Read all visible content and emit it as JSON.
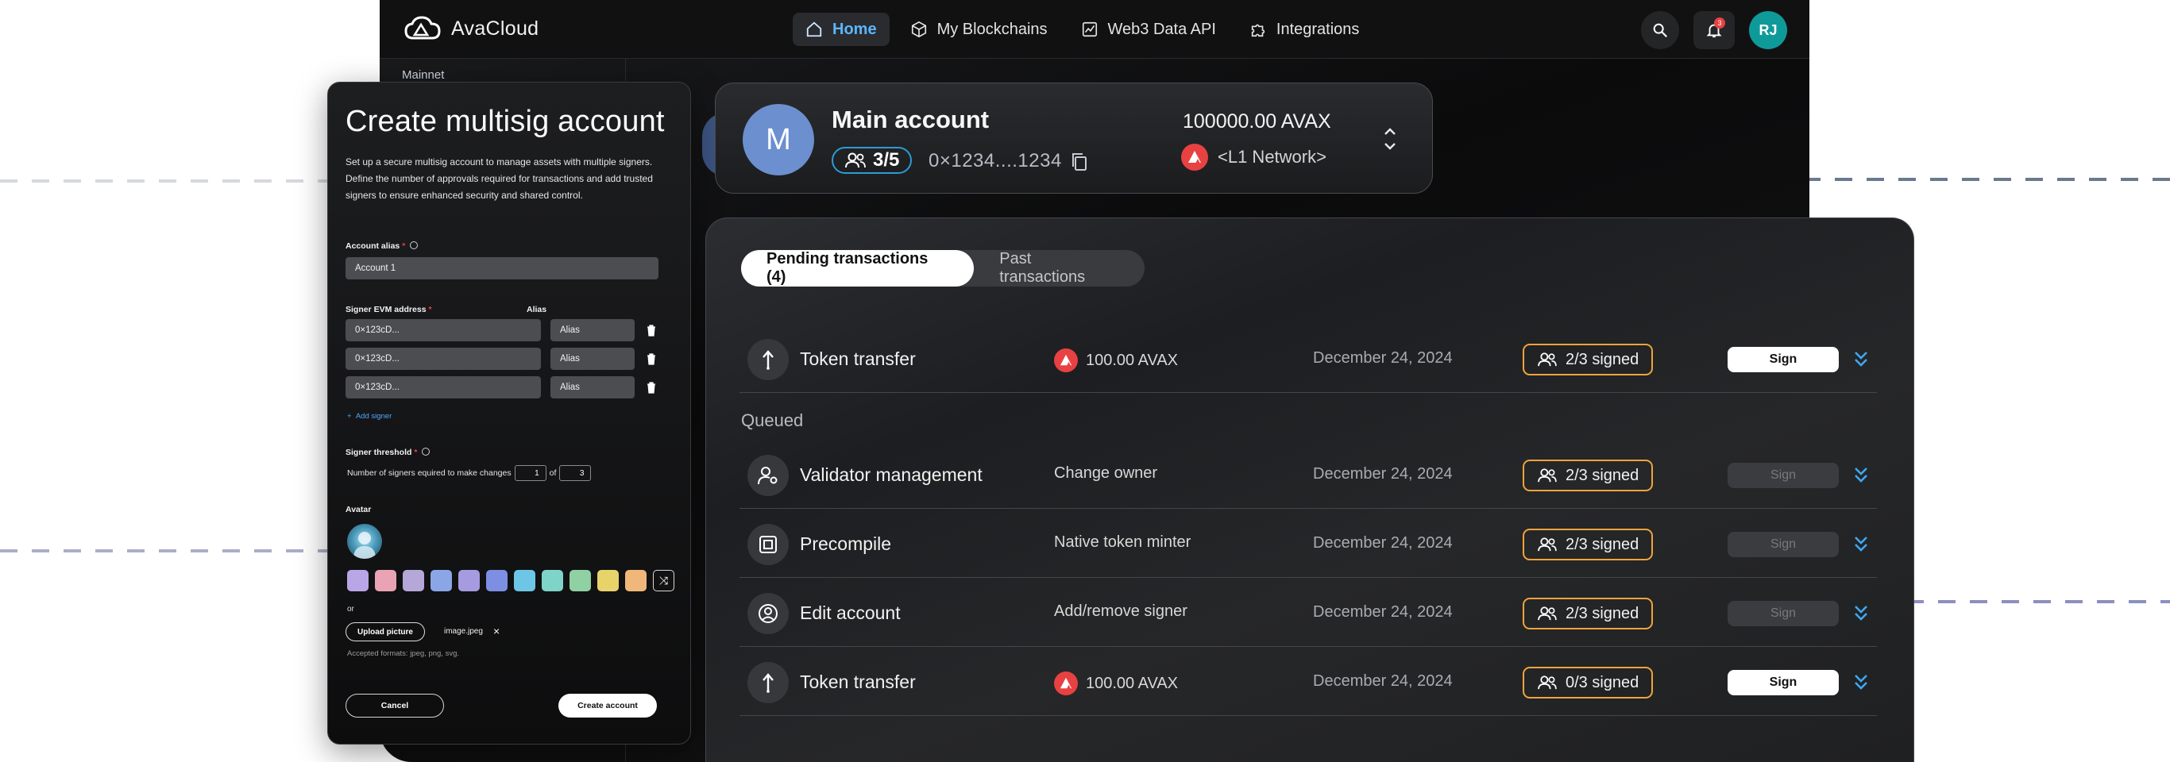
{
  "app": {
    "name": "AvaCloud"
  },
  "nav": {
    "items": [
      {
        "label": "Home",
        "icon": "home-icon",
        "active": true
      },
      {
        "label": "My Blockchains",
        "icon": "cube-icon",
        "active": false
      },
      {
        "label": "Web3 Data API",
        "icon": "chart-icon",
        "active": false
      },
      {
        "label": "Integrations",
        "icon": "puzzle-icon",
        "active": false
      }
    ],
    "notification_count": "3",
    "user_initials": "RJ"
  },
  "sidebar": {
    "network_label": "Mainnet"
  },
  "modal": {
    "title": "Create multisig account",
    "description": "Set up a secure multisig account to manage assets with multiple signers. Define the number of approvals required for transactions and add trusted signers to ensure enhanced security and shared control.",
    "alias_label": "Account alias",
    "alias_value": "Account 1",
    "signer_label": "Signer EVM address",
    "alias_col_label": "Alias",
    "signers": [
      {
        "address": "0×123cD...",
        "alias": "Alias"
      },
      {
        "address": "0×123cD...",
        "alias": "Alias"
      },
      {
        "address": "0×123cD...",
        "alias": "Alias"
      }
    ],
    "add_signer": "Add signer",
    "threshold_label": "Signer threshold",
    "threshold_text": "Number of signers equired to make changes",
    "threshold_value": "1",
    "threshold_of": "of",
    "threshold_total": "3",
    "avatar_label": "Avatar",
    "swatch_colors": [
      "#b8a6e6",
      "#e9a3b4",
      "#b5a7d8",
      "#8aa6e6",
      "#a69be0",
      "#7d8fe3",
      "#6ec6e6",
      "#7ed4c9",
      "#8fd1a2",
      "#e8d36a",
      "#f0b77a"
    ],
    "or_text": "or",
    "upload_label": "Upload picture",
    "file_name": "image.jpeg",
    "accepted_formats": "Accepted formats: jpeg, png, svg.",
    "cancel_label": "Cancel",
    "create_label": "Create account"
  },
  "account": {
    "initial": "M",
    "name": "Main account",
    "signers": "3/5",
    "address": "0×1234....1234",
    "balance": "100000.00 AVAX",
    "network": "<L1 Network>"
  },
  "transactions": {
    "tabs": [
      {
        "label": "Pending transactions (4)",
        "active": true
      },
      {
        "label": "Past transactions",
        "active": false
      }
    ],
    "queued_label": "Queued",
    "sign_label": "Sign",
    "rows": [
      {
        "type": "Token transfer",
        "icon": "transfer-icon",
        "desc": "100.00 AVAX",
        "avax": true,
        "date": "December 24, 2024",
        "status": "2/3 signed",
        "sign_enabled": true
      },
      {
        "type": "Validator management",
        "icon": "user-gear-icon",
        "desc": "Change owner",
        "avax": false,
        "date": "December 24, 2024",
        "status": "2/3 signed",
        "sign_enabled": false
      },
      {
        "type": "Precompile",
        "icon": "chip-icon",
        "desc": "Native token minter",
        "avax": false,
        "date": "December 24, 2024",
        "status": "2/3 signed",
        "sign_enabled": false
      },
      {
        "type": "Edit account",
        "icon": "account-circle-icon",
        "desc": "Add/remove signer",
        "avax": false,
        "date": "December 24, 2024",
        "status": "2/3 signed",
        "sign_enabled": false
      },
      {
        "type": "Token transfer",
        "icon": "transfer-icon",
        "desc": "100.00 AVAX",
        "avax": true,
        "date": "December 24, 2024",
        "status": "0/3 signed",
        "sign_enabled": true
      }
    ]
  }
}
